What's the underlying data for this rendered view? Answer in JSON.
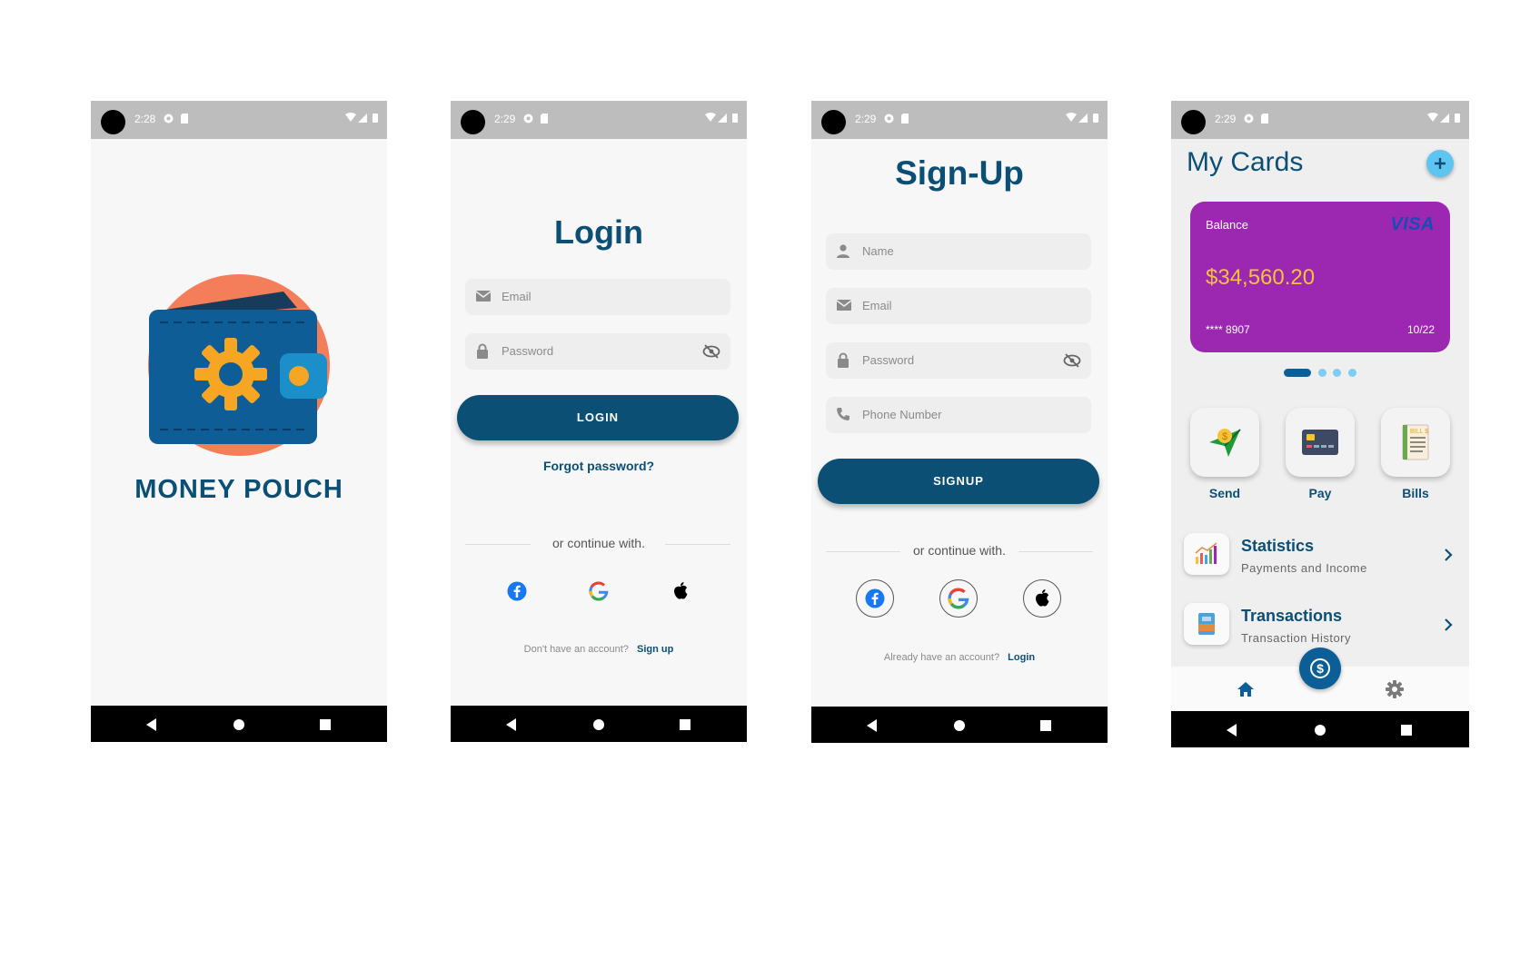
{
  "status": {
    "time_splash": "2:28",
    "time": "2:29"
  },
  "splash": {
    "app_name": "MONEY POUCH"
  },
  "login": {
    "title": "Login",
    "email_placeholder": "Email",
    "password_placeholder": "Password",
    "login_button": "LOGIN",
    "forgot_password": "Forgot password?",
    "or_continue": "or continue with.",
    "no_account": "Don't have an account?",
    "signup_link": "Sign up"
  },
  "signup": {
    "title": "Sign-Up",
    "name_placeholder": "Name",
    "email_placeholder": "Email",
    "password_placeholder": "Password",
    "phone_placeholder": "Phone Number",
    "signup_button": "SIGNUP",
    "or_continue": "or continue with.",
    "have_account": "Already have an account?",
    "login_link": "Login"
  },
  "cards": {
    "title": "My Cards",
    "card": {
      "balance_label": "Balance",
      "brand": "VISA",
      "amount": "$34,560.20",
      "number": "**** 8907",
      "expiry": "10/22",
      "color": "#9c27b0"
    },
    "carousel_active_index": 0,
    "carousel_count": 4,
    "actions": [
      {
        "label": "Send",
        "icon": "send-money-icon"
      },
      {
        "label": "Pay",
        "icon": "credit-card-icon"
      },
      {
        "label": "Bills",
        "icon": "bill-icon"
      }
    ],
    "rows": [
      {
        "title": "Statistics",
        "subtitle": "Payments and Income",
        "icon": "bar-chart-icon"
      },
      {
        "title": "Transactions",
        "subtitle": "Transaction History",
        "icon": "wallet-icon"
      }
    ],
    "bottom_nav": [
      "home-icon",
      "dollar-icon",
      "settings-icon"
    ]
  },
  "colors": {
    "primary": "#0b4f75",
    "accent_yellow": "#f6c338",
    "status_bar": "#bdbdbd"
  }
}
